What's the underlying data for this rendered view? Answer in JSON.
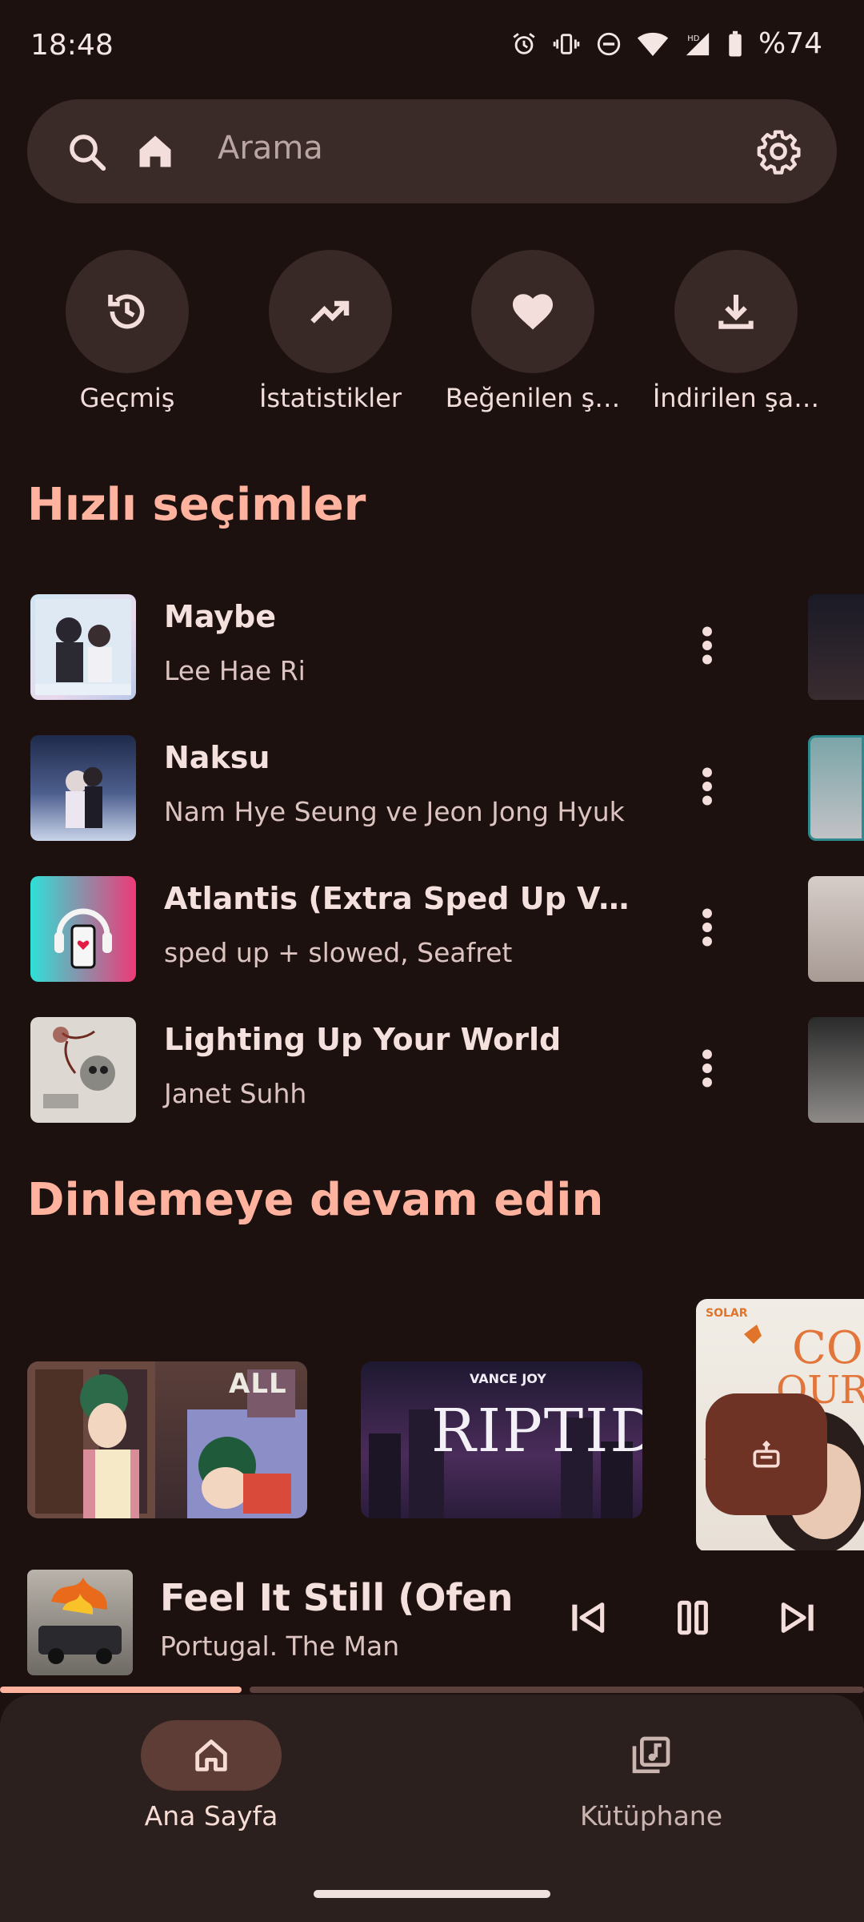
{
  "status_bar": {
    "time": "18:48",
    "battery": "%74"
  },
  "search": {
    "placeholder": "Arama"
  },
  "quick_actions": [
    {
      "label": "Geçmiş",
      "icon": "history-icon"
    },
    {
      "label": "İstatistikler",
      "icon": "trending-up-icon"
    },
    {
      "label": "Beğenilen ş…",
      "icon": "heart-icon"
    },
    {
      "label": "İndirilen şa…",
      "icon": "download-icon"
    }
  ],
  "quick_picks": {
    "title": "Hızlı seçimler",
    "songs": [
      {
        "title": "Maybe",
        "artist": "Lee Hae Ri"
      },
      {
        "title": "Naksu",
        "artist": "Nam Hye Seung ve Jeon Jong Hyuk"
      },
      {
        "title": "Atlantis (Extra Sped Up Vers…",
        "artist": "sped up + slowed, Seafret"
      },
      {
        "title": "Lighting Up Your World",
        "artist": "Janet Suhh"
      }
    ]
  },
  "continue_listening": {
    "title": "Dinlemeye devam edin",
    "cards": [
      {
        "text": "ALL"
      },
      {
        "text": "VANCE JOY",
        "subtitle": "RIPTIDE"
      },
      {
        "text": "SOLAR"
      }
    ]
  },
  "now_playing": {
    "title": "Feel It Still (Ofenba",
    "artist": "Portugal. The Man",
    "progress": 0.28
  },
  "bottom_nav": {
    "items": [
      {
        "label": "Ana Sayfa",
        "active": true
      },
      {
        "label": "Kütüphane",
        "active": false
      }
    ]
  },
  "colors": {
    "accent": "#ffb39f",
    "background": "#1d1110",
    "surface": "#3a2a28",
    "fab": "#6e3324"
  }
}
